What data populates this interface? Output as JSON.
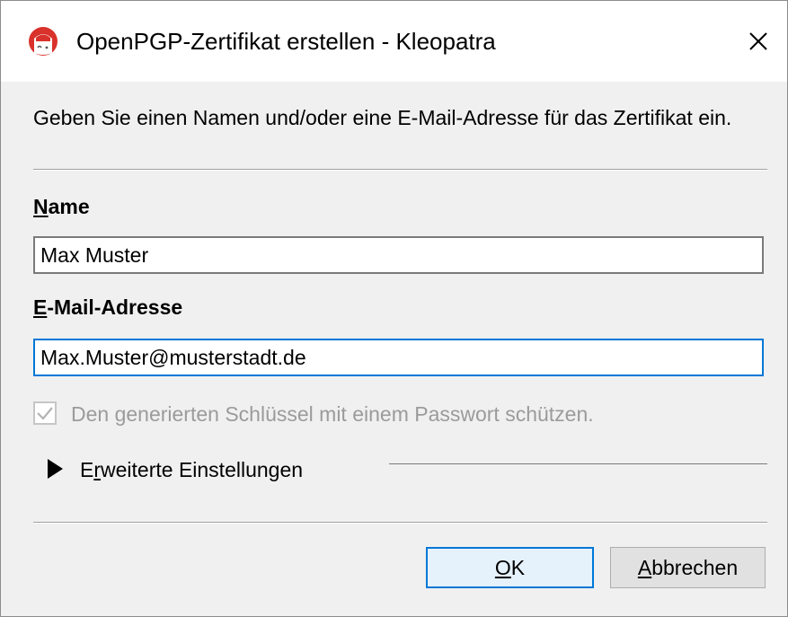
{
  "window": {
    "title": "OpenPGP-Zertifikat erstellen - Kleopatra",
    "close_icon": "close-icon"
  },
  "intro": {
    "text": "Geben Sie einen Namen und/oder eine E-Mail-Adresse für das Zertifikat ein."
  },
  "name": {
    "label_mnemonic": "N",
    "label_rest": "ame",
    "value": "Max Muster"
  },
  "email": {
    "label_mnemonic": "E",
    "label_rest": "-Mail-Adresse",
    "value": "Max.Muster@musterstadt.de"
  },
  "protect": {
    "checked": true,
    "disabled": true,
    "label": "Den generierten Schlüssel mit einem Passwort schützen."
  },
  "advanced": {
    "label_pre": "E",
    "label_mnemonic": "r",
    "label_rest": "weiterte Einstellungen",
    "expanded": false
  },
  "buttons": {
    "ok_mnemonic": "O",
    "ok_rest": "K",
    "cancel_mnemonic": "A",
    "cancel_rest": "bbrechen"
  },
  "colors": {
    "focus_accent": "#0078d7",
    "disabled_text": "#9b9b9b",
    "app_icon_red": "#d9312b"
  }
}
